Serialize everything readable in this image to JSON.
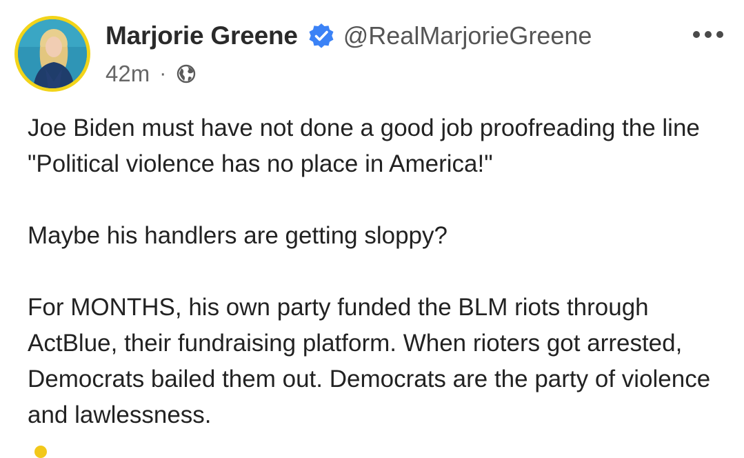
{
  "author": {
    "display_name": "Marjorie Greene",
    "handle": "@RealMarjorieGreene",
    "verified": true
  },
  "post": {
    "timestamp": "42m",
    "separator": "·",
    "visibility_icon": "globe-icon",
    "paragraphs": [
      "Joe Biden must have not done a good job proofreading the line \"Political violence has no place in America!\"",
      "Maybe his handlers are getting sloppy?",
      "For MONTHS, his own party funded the BLM riots through ActBlue, their fundraising platform. When rioters got arrested, Democrats bailed them out. Democrats are the party of violence and lawlessness."
    ]
  },
  "icons": {
    "verified": "verified-badge-icon",
    "more": "more-options-icon",
    "visibility": "globe-icon"
  },
  "colors": {
    "avatar_ring": "#f2d41a",
    "verified_blue": "#3b82f6",
    "name_text": "#2a2a2a",
    "secondary_text": "#555555"
  }
}
